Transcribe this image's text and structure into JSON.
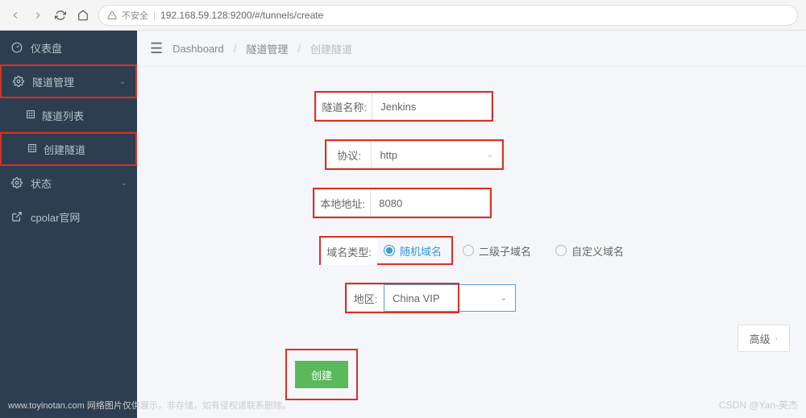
{
  "browser": {
    "insecure_label": "不安全",
    "url": "192.168.59.128:9200/#/tunnels/create"
  },
  "sidebar": {
    "dashboard": "仪表盘",
    "tunnel_mgmt": "隧道管理",
    "tunnel_list": "隧道列表",
    "create_tunnel": "创建隧道",
    "status": "状态",
    "official": "cpolar官网"
  },
  "breadcrumb": {
    "dashboard": "Dashboard",
    "tunnel_mgmt": "隧道管理",
    "create": "创建隧道"
  },
  "form": {
    "name_label": "隧道名称:",
    "name_value": "Jenkins",
    "protocol_label": "协议:",
    "protocol_value": "http",
    "addr_label": "本地地址:",
    "addr_value": "8080",
    "domain_type_label": "域名类型:",
    "domain_random": "随机域名",
    "domain_sub": "二级子域名",
    "domain_custom": "自定义域名",
    "region_label": "地区:",
    "region_value": "China VIP",
    "advanced": "高级",
    "submit": "创建"
  },
  "footer": "www.toyinotan.com 网络图片仅供展示，非存储，如有侵权请联系删除。",
  "watermark": "CSDN @Yan-英杰"
}
